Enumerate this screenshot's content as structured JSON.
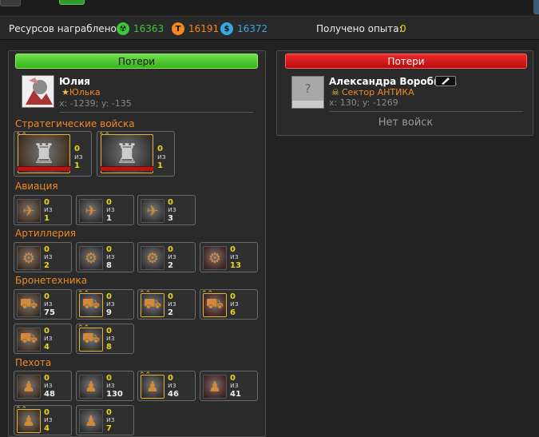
{
  "resources": {
    "label": "Ресурсов награблено:",
    "items": [
      {
        "icon": "radiation-icon",
        "value": "16363",
        "color": "#3cc63c",
        "bg": "#3cc63c"
      },
      {
        "icon": "titanium-icon",
        "value": "16191",
        "color": "#f28a20",
        "bg": "#f28a20"
      },
      {
        "icon": "dollar-icon",
        "value": "16372",
        "color": "#39a7e0",
        "bg": "#39a7e0"
      }
    ],
    "xp_label": "Получено опыта:",
    "xp_value": "0"
  },
  "left": {
    "header": "Потери",
    "player": {
      "name": "Юлия",
      "alliance": "Юлька",
      "alliance_icon": "★",
      "coords": "x: -1239; y: -135"
    },
    "categories": [
      {
        "label": "Стратегические войска",
        "big": true,
        "units": [
          {
            "icon": "walker-icon",
            "glyph": "♜",
            "elite": true,
            "lost": "0",
            "of": "из",
            "total": "1",
            "total_color": "gold"
          },
          {
            "icon": "mech-icon",
            "glyph": "♜",
            "elite": true,
            "lost": "0",
            "of": "из",
            "total": "1",
            "total_color": "gold"
          }
        ]
      },
      {
        "label": "Авиация",
        "units": [
          {
            "icon": "aircraft-icon",
            "glyph": "✈",
            "elite": false,
            "lost": "0",
            "of": "из",
            "total": "1",
            "total_color": "gold"
          },
          {
            "icon": "aircraft-icon",
            "glyph": "✈",
            "elite": false,
            "lost": "0",
            "of": "из",
            "total": "1",
            "total_color": "white"
          },
          {
            "icon": "aircraft-icon",
            "glyph": "✈",
            "elite": false,
            "lost": "0",
            "of": "из",
            "total": "3",
            "total_color": "white"
          }
        ]
      },
      {
        "label": "Артиллерия",
        "units": [
          {
            "icon": "artillery-icon",
            "glyph": "⚙",
            "elite": false,
            "lost": "0",
            "of": "из",
            "total": "2",
            "total_color": "gold"
          },
          {
            "icon": "artillery-icon",
            "glyph": "⚙",
            "elite": false,
            "lost": "0",
            "of": "из",
            "total": "8",
            "total_color": "white"
          },
          {
            "icon": "artillery-icon",
            "glyph": "⚙",
            "elite": false,
            "lost": "0",
            "of": "из",
            "total": "2",
            "total_color": "white"
          },
          {
            "icon": "artillery-icon",
            "glyph": "⚙",
            "elite": false,
            "lost": "0",
            "of": "из",
            "total": "13",
            "total_color": "gold"
          }
        ]
      },
      {
        "label": "Бронетехника",
        "units": [
          {
            "icon": "tank-icon",
            "glyph": "⛟",
            "elite": false,
            "lost": "0",
            "of": "из",
            "total": "75",
            "total_color": "white"
          },
          {
            "icon": "tank-icon",
            "glyph": "⛟",
            "elite": true,
            "lost": "0",
            "of": "из",
            "total": "9",
            "total_color": "white"
          },
          {
            "icon": "tank-icon",
            "glyph": "⛟",
            "elite": true,
            "lost": "0",
            "of": "из",
            "total": "2",
            "total_color": "white"
          },
          {
            "icon": "tank-icon",
            "glyph": "⛟",
            "elite": true,
            "lost": "0",
            "of": "из",
            "total": "6",
            "total_color": "gold"
          },
          {
            "icon": "tank-icon",
            "glyph": "⛟",
            "elite": false,
            "lost": "0",
            "of": "из",
            "total": "4",
            "total_color": "gold"
          },
          {
            "icon": "tank-icon",
            "glyph": "⛟",
            "elite": true,
            "lost": "0",
            "of": "из",
            "total": "8",
            "total_color": "gold"
          }
        ]
      },
      {
        "label": "Пехота",
        "units": [
          {
            "icon": "soldier-icon",
            "glyph": "♟",
            "elite": false,
            "lost": "0",
            "of": "из",
            "total": "48",
            "total_color": "white"
          },
          {
            "icon": "soldier-icon",
            "glyph": "♟",
            "elite": false,
            "lost": "0",
            "of": "из",
            "total": "130",
            "total_color": "white"
          },
          {
            "icon": "soldier-icon",
            "glyph": "♟",
            "elite": true,
            "lost": "0",
            "of": "из",
            "total": "46",
            "total_color": "white"
          },
          {
            "icon": "soldier-icon",
            "glyph": "♟",
            "elite": false,
            "lost": "0",
            "of": "из",
            "total": "41",
            "total_color": "white"
          },
          {
            "icon": "soldier-icon",
            "glyph": "♟",
            "elite": true,
            "lost": "0",
            "of": "из",
            "total": "4",
            "total_color": "gold"
          },
          {
            "icon": "soldier-icon",
            "glyph": "♟",
            "elite": false,
            "lost": "0",
            "of": "из",
            "total": "7",
            "total_color": "gold"
          }
        ]
      }
    ]
  },
  "right": {
    "header": "Потери",
    "player": {
      "name": "Александра Воробье...",
      "alliance": "Сектор АНТИКА",
      "alliance_icon": "☠",
      "coords": "x: 130; y: -1269",
      "avatar_glyph": "?"
    },
    "empty_text": "Нет войск"
  }
}
